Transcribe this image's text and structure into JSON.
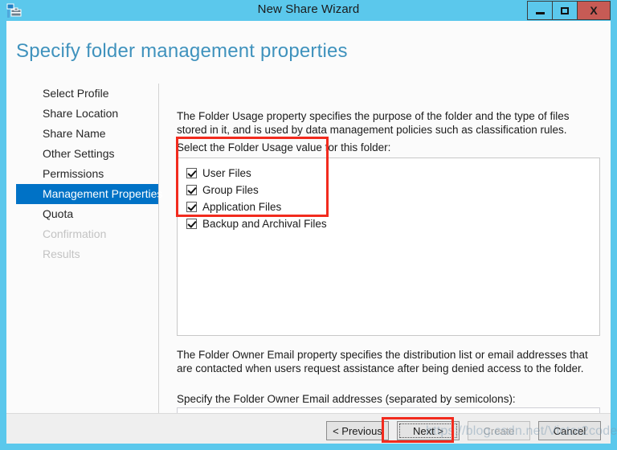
{
  "window": {
    "title": "New Share Wizard",
    "icon": "share-folder-icon",
    "controls": {
      "minimize": "minimize-icon",
      "maximize": "maximize-icon",
      "close_label": "X"
    },
    "accent_color": "#5bc8ec",
    "close_color": "#c75b55"
  },
  "page": {
    "heading": "Specify folder management properties",
    "heading_color": "#3f92bd"
  },
  "sidebar": {
    "items": [
      {
        "label": "Select Profile",
        "state": "normal"
      },
      {
        "label": "Share Location",
        "state": "normal"
      },
      {
        "label": "Share Name",
        "state": "normal"
      },
      {
        "label": "Other Settings",
        "state": "normal"
      },
      {
        "label": "Permissions",
        "state": "normal"
      },
      {
        "label": "Management Properties",
        "state": "selected"
      },
      {
        "label": "Quota",
        "state": "normal"
      },
      {
        "label": "Confirmation",
        "state": "disabled"
      },
      {
        "label": "Results",
        "state": "disabled"
      }
    ],
    "selected_color": "#0072c6"
  },
  "main": {
    "folder_usage_description": "The Folder Usage property specifies the purpose of the folder and the type of files stored in it, and is used by data management policies such as classification rules.",
    "folder_usage_label": "Select the Folder Usage value for this folder:",
    "folder_usage_options": [
      {
        "label": "User Files",
        "checked": true
      },
      {
        "label": "Group Files",
        "checked": true
      },
      {
        "label": "Application Files",
        "checked": true
      },
      {
        "label": "Backup and Archival Files",
        "checked": true
      }
    ],
    "owner_email_description": "The Folder Owner Email property specifies the distribution list or email addresses that are contacted when users request assistance after being denied access to the folder.",
    "owner_email_label": "Specify the Folder Owner Email addresses (separated by semicolons):",
    "owner_email_value": "",
    "owner_email_placeholder": ""
  },
  "footer": {
    "previous_label": "< Previous",
    "next_label": "Next >",
    "create_label": "Create",
    "cancel_label": "Cancel"
  },
  "annotations": {
    "color": "#f22b1e",
    "targets": [
      "folder-usage-list",
      "next-button"
    ]
  },
  "watermark": {
    "text": "https://blog.csdn.net/Victor2code"
  }
}
